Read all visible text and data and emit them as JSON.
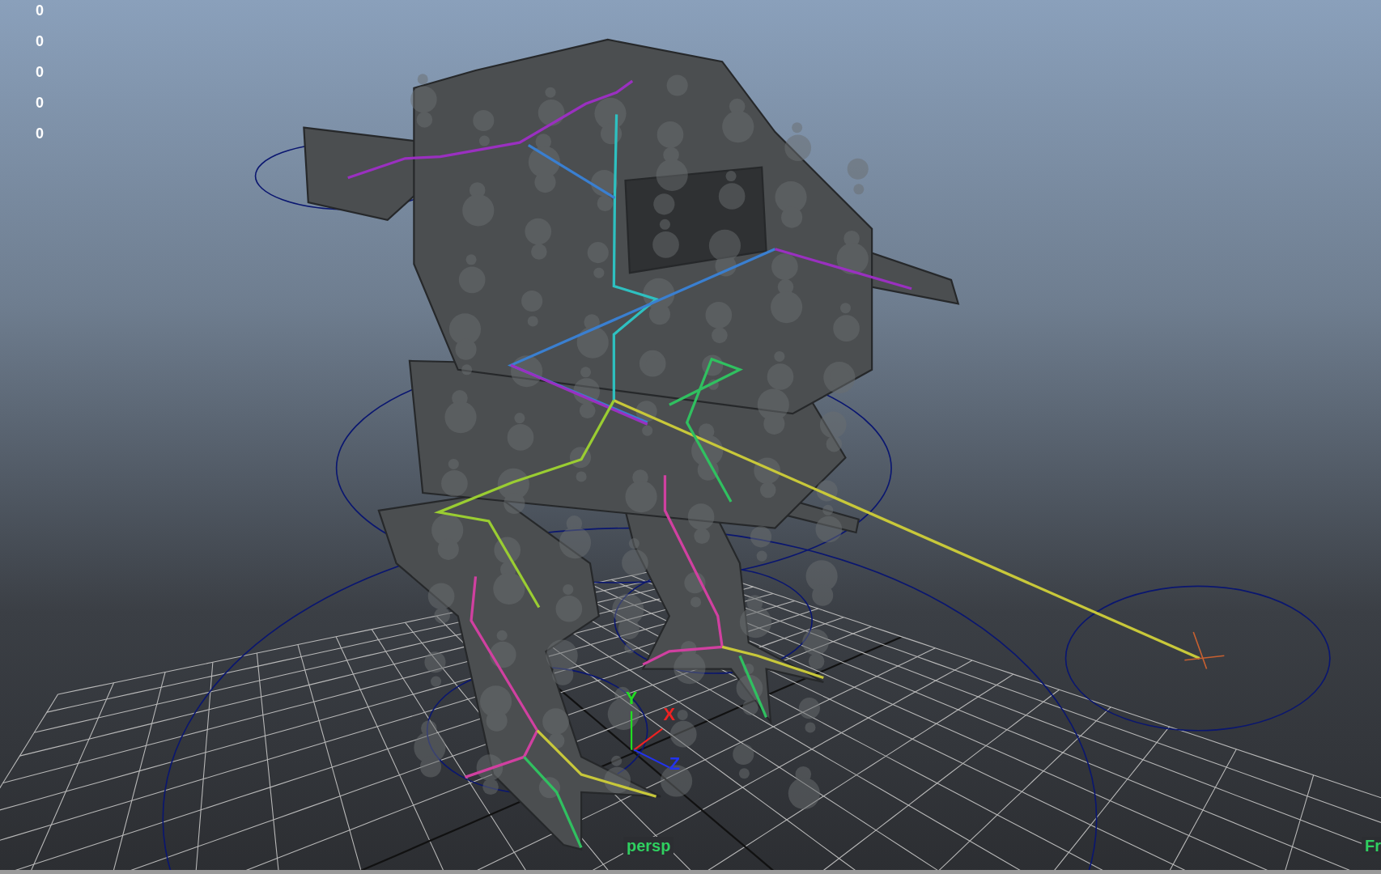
{
  "hud_values": [
    "0",
    "0",
    "0",
    "0",
    "0"
  ],
  "axis_labels": [
    {
      "label": "Y",
      "color": "#22dd22"
    },
    {
      "label": "X",
      "color": "#ee2222"
    },
    {
      "label": "Z",
      "color": "#2233ee"
    }
  ],
  "camera_label": "persp",
  "corner_label": "Fr"
}
